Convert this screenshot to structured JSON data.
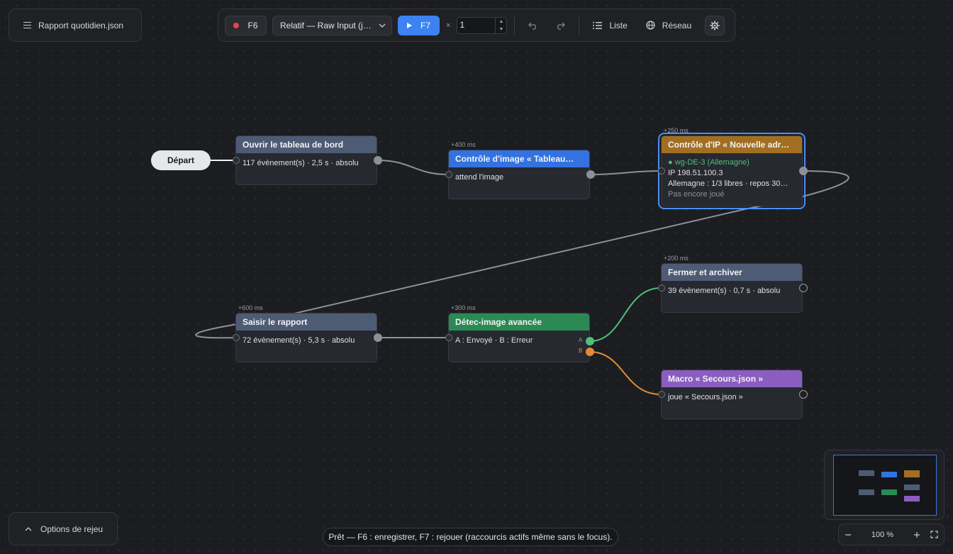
{
  "file": {
    "name": "Rapport quotidien.json"
  },
  "toolbar": {
    "record_key": "F6",
    "mode": "Relatif — Raw Input (j…",
    "play_key": "F7",
    "times": "×",
    "repeat_count": "1",
    "list_label": "Liste",
    "network_label": "Réseau"
  },
  "graph": {
    "start": "Départ",
    "nodes": {
      "open_dashboard": {
        "title": "Ouvrir le tableau de bord",
        "body": "117 évènement(s) · 2,5 s · absolu"
      },
      "image_check": {
        "delay": "+400 ms",
        "title": "Contrôle d'image « Tableau…",
        "body": "attend l'image"
      },
      "ip_check": {
        "delay": "+250 ms",
        "title": "Contrôle d'IP « Nouvelle adr…",
        "vpn": "● wg-DE-3 (Allemagne)",
        "ip": "IP 198.51.100.3",
        "country": "Allemagne : 1/3 libres · repos 30…",
        "status": "Pas encore joué"
      },
      "close_archive": {
        "delay": "+200 ms",
        "title": "Fermer et archiver",
        "body": "39 évènement(s) · 0,7 s · absolu"
      },
      "enter_report": {
        "delay": "+600 ms",
        "title": "Saisir le rapport",
        "body": "72 évènement(s) · 5,3 s · absolu"
      },
      "advanced_detect": {
        "delay": "+300 ms",
        "title": "Détec-image avancée",
        "body": "A : Envoyé · B : Erreur",
        "port_a": "A",
        "port_b": "B"
      },
      "macro_fallback": {
        "title": "Macro « Secours.json »",
        "body": "joue « Secours.json »"
      }
    }
  },
  "colors": {
    "branch_a": "#4fbf7d",
    "branch_b": "#e58a3a",
    "selection": "#4a8ff5",
    "play": "#3c82f0",
    "record": "#ea4150"
  },
  "footer": {
    "replay_options": "Options de rejeu",
    "status": "Prêt — F6 : enregistrer, F7 : rejouer (raccourcis actifs même sans le focus).",
    "zoom": "100 %"
  }
}
